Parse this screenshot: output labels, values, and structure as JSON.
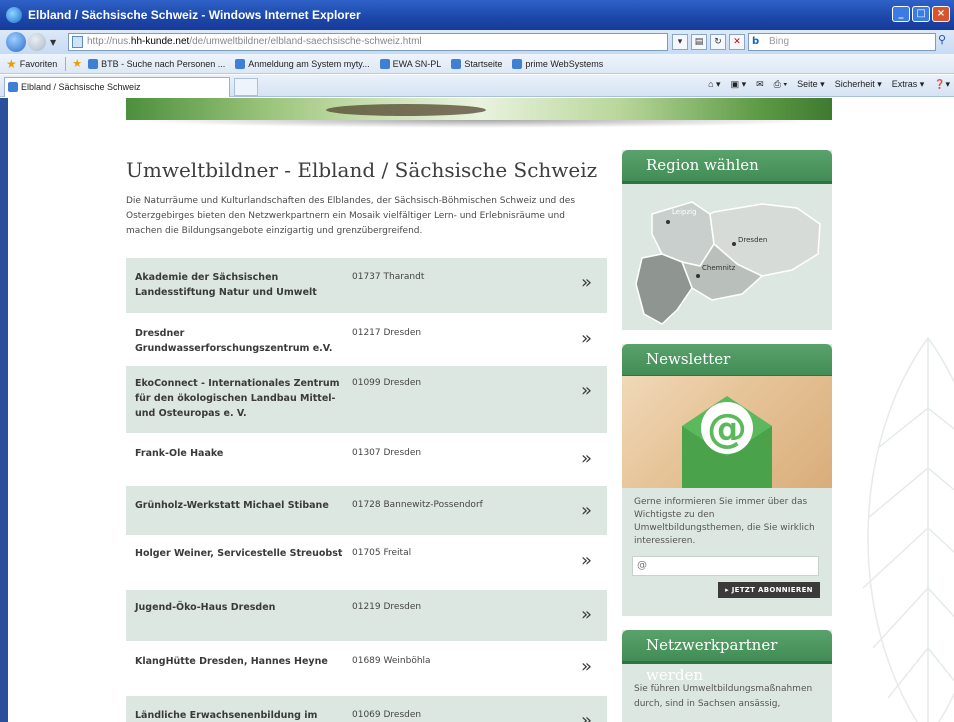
{
  "window": {
    "title": "Elbland / Sächsische Schweiz - Windows Internet Explorer"
  },
  "address": {
    "url_prefix": "http://nus.",
    "url_host": "hh-kunde.net",
    "url_path": "/de/umweltbildner/elbland-saechsische-schweiz.html",
    "search_engine": "Bing",
    "search_placeholder": "Bing"
  },
  "favorites": {
    "label": "Favoriten",
    "items": [
      "BTB - Suche nach Personen ...",
      "Anmeldung am System myty...",
      "EWA SN-PL",
      "Startseite",
      "prime WebSystems"
    ]
  },
  "tabs": [
    {
      "label": "Elbland / Sächsische Schweiz"
    }
  ],
  "commandbar": {
    "page": "Seite ▾",
    "safety": "Sicherheit ▾",
    "extras": "Extras ▾"
  },
  "main": {
    "title": "Umweltbildner - Elbland / Sächsische Schweiz",
    "intro": "Die Naturräume und Kulturlandschaften des Elblandes, der Sächsisch-Böhmischen Schweiz und des Osterzgebirges bieten den Netzwerkpartnern ein Mosaik vielfältiger Lern- und Erlebnisräume und machen die Bildungsangebote einzigartig und grenzübergreifend.",
    "partners": [
      {
        "name": "Akademie der Sächsischen Landesstiftung Natur und Umwelt",
        "addr": "01737 Tharandt",
        "arrow": "»"
      },
      {
        "name": "Dresdner Grundwasserforschungszentrum e.V.",
        "addr": "01217 Dresden",
        "arrow": "»"
      },
      {
        "name": "EkoConnect - Internationales Zentrum für den ökologischen Landbau Mittel- und Osteuropas e. V.",
        "addr": "01099 Dresden",
        "arrow": "»"
      },
      {
        "name": "Frank-Ole Haake",
        "addr": "01307 Dresden",
        "arrow": "»"
      },
      {
        "name": "Grünholz-Werkstatt Michael Stibane",
        "addr": "01728 Bannewitz-Possendorf",
        "arrow": "»"
      },
      {
        "name": "Holger Weiner, Servicestelle Streuobst",
        "addr": "01705 Freital",
        "arrow": "»"
      },
      {
        "name": "Jugend-Öko-Haus Dresden",
        "addr": "01219 Dresden",
        "arrow": "»"
      },
      {
        "name": "KlangHütte Dresden, Hannes Heyne",
        "addr": "01689 Weinböhla",
        "arrow": "»"
      },
      {
        "name": "Ländliche Erwachsenenbildung im",
        "addr": "01069 Dresden",
        "arrow": "»"
      }
    ]
  },
  "sidebar": {
    "region": {
      "title": "Region wählen",
      "cities": {
        "leipzig": "Leipzig",
        "dresden": "Dresden",
        "chemnitz": "Chemnitz"
      }
    },
    "newsletter": {
      "title": "Newsletter",
      "text": "Gerne informieren Sie immer über das Wichtigste zu den Umweltbildungsthemen, die Sie wirklich interessieren.",
      "email_prefix": "@",
      "button": "▸ JETZT ABONNIEREN"
    },
    "partner": {
      "title": "Netzwerkpartner werden",
      "text": "Sie führen Umweltbildungsmaßnahmen durch, sind in Sachsen ansässig,"
    }
  }
}
